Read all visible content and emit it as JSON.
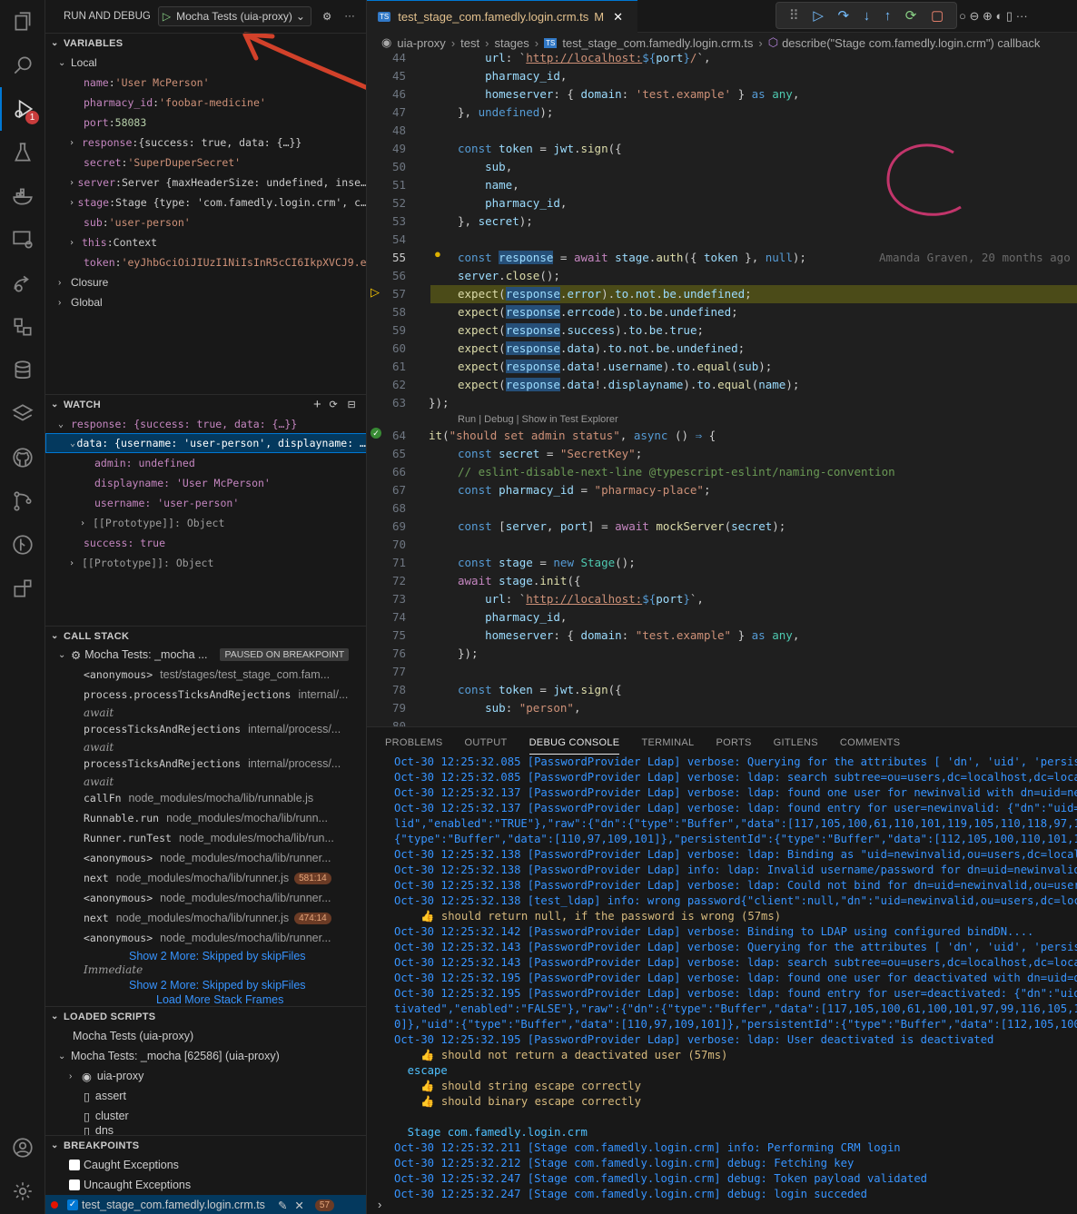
{
  "sidebar": {
    "title": "RUN AND DEBUG",
    "config": "Mocha Tests (uia-proxy)",
    "variables": {
      "header": "VARIABLES",
      "local": "Local",
      "items": [
        {
          "name": "name",
          "value": "'User McPerson'",
          "kind": "s"
        },
        {
          "name": "pharmacy_id",
          "value": "'foobar-medicine'",
          "kind": "s"
        },
        {
          "name": "port",
          "value": "58083",
          "kind": "n"
        },
        {
          "name": "response",
          "value": "{success: true, data: {…}}",
          "kind": "o",
          "exp": true
        },
        {
          "name": "secret",
          "value": "'SuperDuperSecret'",
          "kind": "s"
        },
        {
          "name": "server",
          "value": "Server {maxHeaderSize: undefined, inse…",
          "kind": "o",
          "exp": true
        },
        {
          "name": "stage",
          "value": "Stage {type: 'com.famedly.login.crm', c…",
          "kind": "o",
          "exp": true
        },
        {
          "name": "sub",
          "value": "'user-person'",
          "kind": "s"
        },
        {
          "name": "this",
          "value": "Context",
          "kind": "o",
          "exp": true
        },
        {
          "name": "token",
          "value": "'eyJhbGciOiJIUzI1NiIsInR5cCI6IkpXVCJ9.e…",
          "kind": "s"
        }
      ],
      "closure": "Closure",
      "global": "Global"
    },
    "watch": {
      "header": "WATCH",
      "root": "response: {success: true, data: {…}}",
      "data_row": "data: {username: 'user-person', displayname: …",
      "admin": "admin: undefined",
      "displayname": "displayname: 'User McPerson'",
      "username": "username: 'user-person'",
      "proto1": "[[Prototype]]: Object",
      "success": "success: true",
      "proto2": "[[Prototype]]: Object"
    },
    "callstack": {
      "header": "CALL STACK",
      "thread": "Mocha Tests: _mocha ...",
      "state": "PAUSED ON BREAKPOINT",
      "frames": [
        {
          "fn": "<anonymous>",
          "file": "test/stages/test_stage_com.fam...",
          "pill": ""
        },
        {
          "fn": "process.processTicksAndRejections",
          "file": "internal/...",
          "pill": ""
        },
        {
          "fn": "await",
          "file": "",
          "pill": "",
          "aw": true
        },
        {
          "fn": "processTicksAndRejections",
          "file": "internal/process/...",
          "pill": ""
        },
        {
          "fn": "await",
          "file": "",
          "pill": "",
          "aw": true
        },
        {
          "fn": "processTicksAndRejections",
          "file": "internal/process/...",
          "pill": ""
        },
        {
          "fn": "await",
          "file": "",
          "pill": "",
          "aw": true
        },
        {
          "fn": "callFn",
          "file": "node_modules/mocha/lib/runnable.js",
          "pill": ""
        },
        {
          "fn": "Runnable.run",
          "file": "node_modules/mocha/lib/runn...",
          "pill": ""
        },
        {
          "fn": "Runner.runTest",
          "file": "node_modules/mocha/lib/run...",
          "pill": ""
        },
        {
          "fn": "<anonymous>",
          "file": "node_modules/mocha/lib/runner...",
          "pill": ""
        },
        {
          "fn": "next",
          "file": "node_modules/mocha/lib/runner.js",
          "pill": "581:14"
        },
        {
          "fn": "<anonymous>",
          "file": "node_modules/mocha/lib/runner...",
          "pill": ""
        },
        {
          "fn": "next",
          "file": "node_modules/mocha/lib/runner.js",
          "pill": "474:14"
        },
        {
          "fn": "<anonymous>",
          "file": "node_modules/mocha/lib/runner...",
          "pill": ""
        }
      ],
      "show_more1": "Show 2 More: Skipped by skipFiles",
      "immediate": "Immediate",
      "show_more2": "Show 2 More: Skipped by skipFiles",
      "load_more": "Load More Stack Frames"
    },
    "scripts": {
      "header": "LOADED SCRIPTS",
      "item1": "Mocha Tests (uia-proxy)",
      "item2": "Mocha Tests: _mocha [62586] (uia-proxy)",
      "children": [
        "uia-proxy",
        "assert",
        "cluster",
        "dns"
      ]
    },
    "breakpoints": {
      "header": "BREAKPOINTS",
      "caught": "Caught Exceptions",
      "uncaught": "Uncaught Exceptions",
      "file": "test_stage_com.famedly.login.crm.ts",
      "line": "57"
    }
  },
  "editor": {
    "tab": "test_stage_com.famedly.login.crm.ts",
    "tab_mark": "M",
    "breadcrumbs": [
      "uia-proxy",
      "test",
      "stages",
      "test_stage_com.famedly.login.crm.ts",
      "describe(\"Stage com.famedly.login.crm\") callback"
    ],
    "blame": "Amanda Graven, 20 months ago",
    "codelens": "Run | Debug | Show in Test Explorer",
    "line_numbers": [
      "44",
      "45",
      "46",
      "47",
      "48",
      "49",
      "50",
      "51",
      "52",
      "53",
      "54",
      "55",
      "56",
      "57",
      "58",
      "59",
      "60",
      "61",
      "62",
      "63",
      "64",
      "65",
      "66",
      "67",
      "68",
      "69",
      "70",
      "71",
      "72",
      "73",
      "74",
      "75",
      "76",
      "77",
      "78",
      "79",
      "80"
    ]
  },
  "panel": {
    "tabs": [
      "PROBLEMS",
      "OUTPUT",
      "DEBUG CONSOLE",
      "TERMINAL",
      "PORTS",
      "GITLENS",
      "COMMENTS"
    ],
    "lines": [
      "Oct-30 12:25:32.085 [PasswordProvider Ldap] verbose: Querying for the attributes [ 'dn', 'uid', 'persiste",
      "Oct-30 12:25:32.085 [PasswordProvider Ldap] verbose: ldap: search subtree=ou=users,dc=localhost,dc=locald",
      "Oct-30 12:25:32.137 [PasswordProvider Ldap] verbose: ldap: found one user for newinvalid with dn=uid=newi",
      "Oct-30 12:25:32.137 [PasswordProvider Ldap] verbose: ldap: found entry for user=newinvalid: {\"dn\":\"uid=ne",
      "lid\",\"enabled\":\"TRUE\"},\"raw\":{\"dn\":{\"type\":\"Buffer\",\"data\":[117,105,100,61,110,101,119,105,110,118,97,108",
      "{\"type\":\"Buffer\",\"data\":[110,97,109,101]},\"persistentId\":{\"type\":\"Buffer\",\"data\":[112,105,100,110,101,119",
      "Oct-30 12:25:32.138 [PasswordProvider Ldap] verbose: ldap: Binding as \"uid=newinvalid,ou=users,dc=localho",
      "Oct-30 12:25:32.138 [PasswordProvider Ldap] info: ldap: Invalid username/password for dn=uid=newinvalid,o",
      "Oct-30 12:25:32.138 [PasswordProvider Ldap] verbose: ldap: Could not bind for dn=uid=newinvalid,ou=users",
      "Oct-30 12:25:32.138 [test_ldap] info: wrong password{\"client\":null,\"dn\":\"uid=newinvalid,ou=users,dc=loca",
      "    👍 should return null, if the password is wrong (57ms)",
      "Oct-30 12:25:32.142 [PasswordProvider Ldap] verbose: Binding to LDAP using configured bindDN....",
      "Oct-30 12:25:32.143 [PasswordProvider Ldap] verbose: Querying for the attributes [ 'dn', 'uid', 'persiste",
      "Oct-30 12:25:32.143 [PasswordProvider Ldap] verbose: ldap: search subtree=ou=users,dc=localhost,dc=locald",
      "Oct-30 12:25:32.195 [PasswordProvider Ldap] verbose: ldap: found one user for deactivated with dn=uid=dea",
      "Oct-30 12:25:32.195 [PasswordProvider Ldap] verbose: ldap: found entry for user=deactivated: {\"dn\":\"uid=d",
      "tivated\",\"enabled\":\"FALSE\"},\"raw\":{\"dn\":{\"type\":\"Buffer\",\"data\":[117,105,100,61,100,101,97,99,116,105,118",
      "0]},\"uid\":{\"type\":\"Buffer\",\"data\":[110,97,109,101]},\"persistentId\":{\"type\":\"Buffer\",\"data\":[112,105,100,1",
      "Oct-30 12:25:32.195 [PasswordProvider Ldap] verbose: ldap: User deactivated is deactivated",
      "    👍 should not return a deactivated user (57ms)",
      "  escape",
      "    👍 should string escape correctly",
      "    👍 should binary escape correctly",
      "",
      "  Stage com.famedly.login.crm",
      "Oct-30 12:25:32.211 [Stage com.famedly.login.crm] info: Performing CRM login",
      "Oct-30 12:25:32.212 [Stage com.famedly.login.crm] debug: Fetching key",
      "Oct-30 12:25:32.247 [Stage com.famedly.login.crm] debug: Token payload validated",
      "Oct-30 12:25:32.247 [Stage com.famedly.login.crm] debug: login succeded"
    ],
    "prompt": "›"
  }
}
